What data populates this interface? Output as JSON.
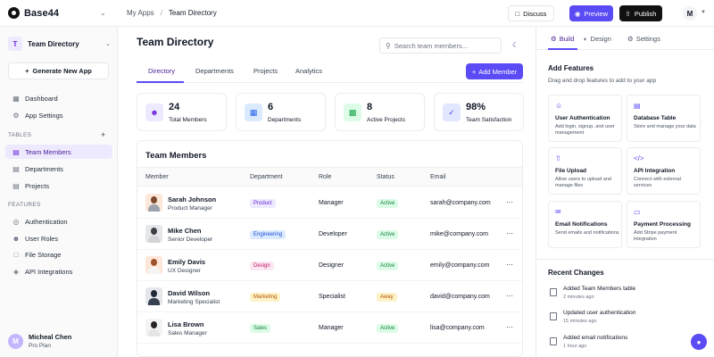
{
  "brand": {
    "name": "Base44"
  },
  "breadcrumb": {
    "parent": "My Apps",
    "separator": "/",
    "current": "Team Directory"
  },
  "topbar": {
    "discuss": "Discuss",
    "preview": "Preview",
    "publish": "Publish",
    "user_initial": "M"
  },
  "sidebar": {
    "project": {
      "initial": "T",
      "name": "Team Directory"
    },
    "generate_label": "Generate New App",
    "top_items": [
      {
        "label": "Dashboard",
        "icon": "dashboard-icon"
      },
      {
        "label": "App Settings",
        "icon": "gear-icon"
      }
    ],
    "tables_label": "TABLES",
    "tables": [
      {
        "label": "Team Members",
        "icon": "table-icon",
        "active": true
      },
      {
        "label": "Departments",
        "icon": "table-icon",
        "active": false
      },
      {
        "label": "Projects",
        "icon": "table-icon",
        "active": false
      }
    ],
    "features_label": "FEATURES",
    "features": [
      {
        "label": "Authentication",
        "icon": "lock-icon"
      },
      {
        "label": "User Roles",
        "icon": "users-icon"
      },
      {
        "label": "File Storage",
        "icon": "file-icon"
      },
      {
        "label": "API Integrations",
        "icon": "plug-icon"
      }
    ],
    "user": {
      "initial": "M",
      "name": "Micheal Chen",
      "plan": "Pro Plan"
    }
  },
  "main": {
    "title": "Team Directory",
    "search_placeholder": "Search team members...",
    "tabs": [
      "Directory",
      "Departments",
      "Projects",
      "Analytics"
    ],
    "add_member": "Add Member",
    "stats": [
      {
        "value": "24",
        "label": "Total Members",
        "icon": "users-icon",
        "color": "#6d28d9",
        "bg": "#ede9fe"
      },
      {
        "value": "6",
        "label": "Departments",
        "icon": "building-icon",
        "color": "#2563eb",
        "bg": "#dbeafe"
      },
      {
        "value": "8",
        "label": "Active Projects",
        "icon": "briefcase-icon",
        "color": "#16a34a",
        "bg": "#dcfce7"
      },
      {
        "value": "98%",
        "label": "Team Satisfaction",
        "icon": "check-circle-icon",
        "color": "#4f46e5",
        "bg": "#e0e7ff"
      }
    ],
    "table": {
      "title": "Team Members",
      "columns": [
        "Member",
        "Department",
        "Role",
        "Status",
        "Email"
      ],
      "rows": [
        {
          "name": "Sarah Johnson",
          "title": "Product Manager",
          "department": "Product",
          "role": "Manager",
          "status": "Active",
          "email": "sarah@company.com"
        },
        {
          "name": "Mike Chen",
          "title": "Senior Developer",
          "department": "Engineering",
          "role": "Developer",
          "status": "Active",
          "email": "mike@company.com"
        },
        {
          "name": "Emily Davis",
          "title": "UX Designer",
          "department": "Design",
          "role": "Designer",
          "status": "Active",
          "email": "emily@company.com"
        },
        {
          "name": "David Wilson",
          "title": "Marketing Specialist",
          "department": "Marketing",
          "role": "Specialist",
          "status": "Away",
          "email": "david@company.com"
        },
        {
          "name": "Lisa Brown",
          "title": "Sales Manager",
          "department": "Sales",
          "role": "Manager",
          "status": "Active",
          "email": "lisa@company.com"
        }
      ]
    }
  },
  "panel": {
    "tabs": [
      "Build",
      "Design",
      "Settings"
    ],
    "add_features_title": "Add Features",
    "add_features_sub": "Drag and drop features to add to your app",
    "features": [
      {
        "title": "User Authentication",
        "desc": "Add login, signup, and user management",
        "icon": "user-icon"
      },
      {
        "title": "Database Table",
        "desc": "Store and manage your data",
        "icon": "table-icon"
      },
      {
        "title": "File Upload",
        "desc": "Allow users to upload and manage files",
        "icon": "upload-icon"
      },
      {
        "title": "API Integration",
        "desc": "Connect with external services",
        "icon": "code-icon"
      },
      {
        "title": "Email Notifications",
        "desc": "Send emails and notifications",
        "icon": "mail-icon"
      },
      {
        "title": "Payment Processing",
        "desc": "Add Stripe payment integration",
        "icon": "card-icon"
      }
    ],
    "recent_title": "Recent Changes",
    "changes": [
      {
        "title": "Added Team Members table",
        "time": "2 minutes ago"
      },
      {
        "title": "Updated user authentication",
        "time": "15 minutes ago"
      },
      {
        "title": "Added email notifications",
        "time": "1 hour ago"
      }
    ]
  }
}
